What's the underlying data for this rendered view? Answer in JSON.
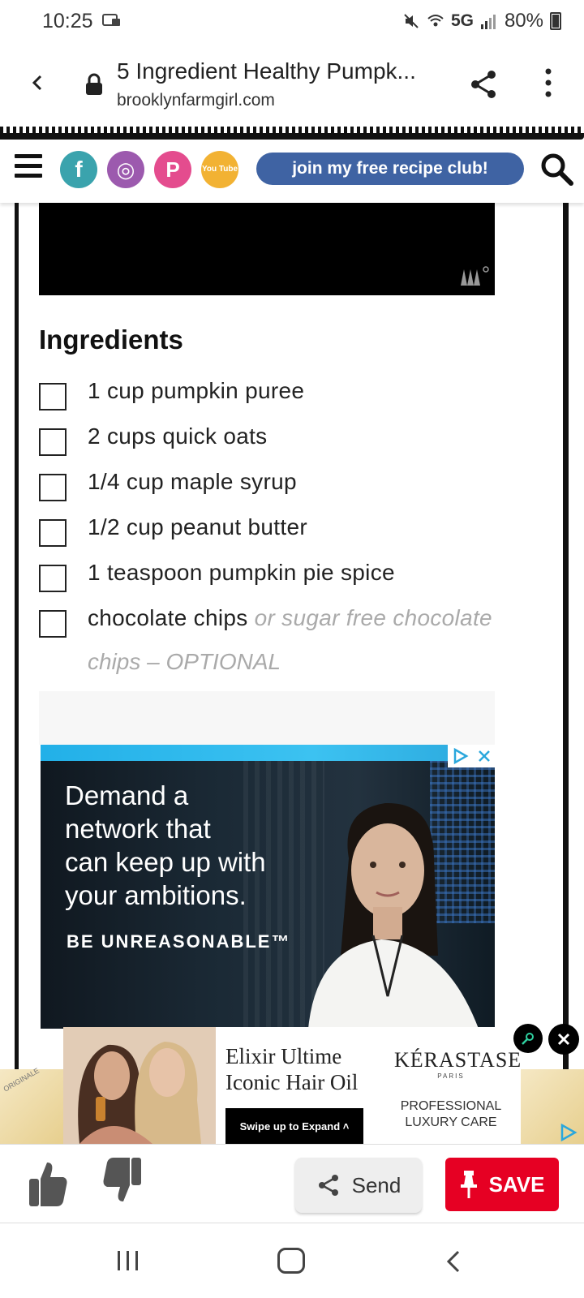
{
  "status": {
    "time": "10:25",
    "network": "5G",
    "battery": "80%"
  },
  "browser": {
    "title": "5 Ingredient Healthy Pumpk...",
    "url": "brooklynfarmgirl.com"
  },
  "site_nav": {
    "club_label": "join my free recipe club!",
    "social": [
      {
        "name": "facebook",
        "glyph": "f",
        "color": "#3aa3ad"
      },
      {
        "name": "instagram",
        "glyph": "◎",
        "color": "#9c5aae"
      },
      {
        "name": "pinterest",
        "glyph": "P",
        "color": "#e44c8e"
      },
      {
        "name": "youtube",
        "glyph": "You Tube",
        "color": "#f2b233"
      }
    ]
  },
  "recipe": {
    "ingredients_heading": "Ingredients",
    "ingredients": [
      {
        "text": "1 cup pumpkin puree"
      },
      {
        "text": "2 cups quick oats"
      },
      {
        "text": "1/4 cup maple syrup"
      },
      {
        "text": "1/2 cup peanut butter"
      },
      {
        "text": "1 teaspoon pumpkin pie spice"
      },
      {
        "text": "chocolate chips",
        "note": "or sugar free chocolate",
        "note2": "chips – OPTIONAL"
      }
    ]
  },
  "network_ad": {
    "headline_lines": [
      "Demand a",
      "network that",
      "can keep up with",
      "your ambitions."
    ],
    "tagline": "BE UNREASONABLE™"
  },
  "hair_ad": {
    "title_line1": "Elixir Ultime",
    "title_line2": "Iconic Hair Oil",
    "swipe_label": "Swipe up to Expand ˄",
    "brand": "KÉRASTASE",
    "brand_sub": "PARIS",
    "care_line1": "PROFESSIONAL",
    "care_line2": "LUXURY CARE",
    "strip_left": "ORIGINALE"
  },
  "actions": {
    "send_label": "Send",
    "save_label": "SAVE"
  },
  "colors": {
    "save_red": "#e60023",
    "club_blue": "#3f63a3"
  }
}
